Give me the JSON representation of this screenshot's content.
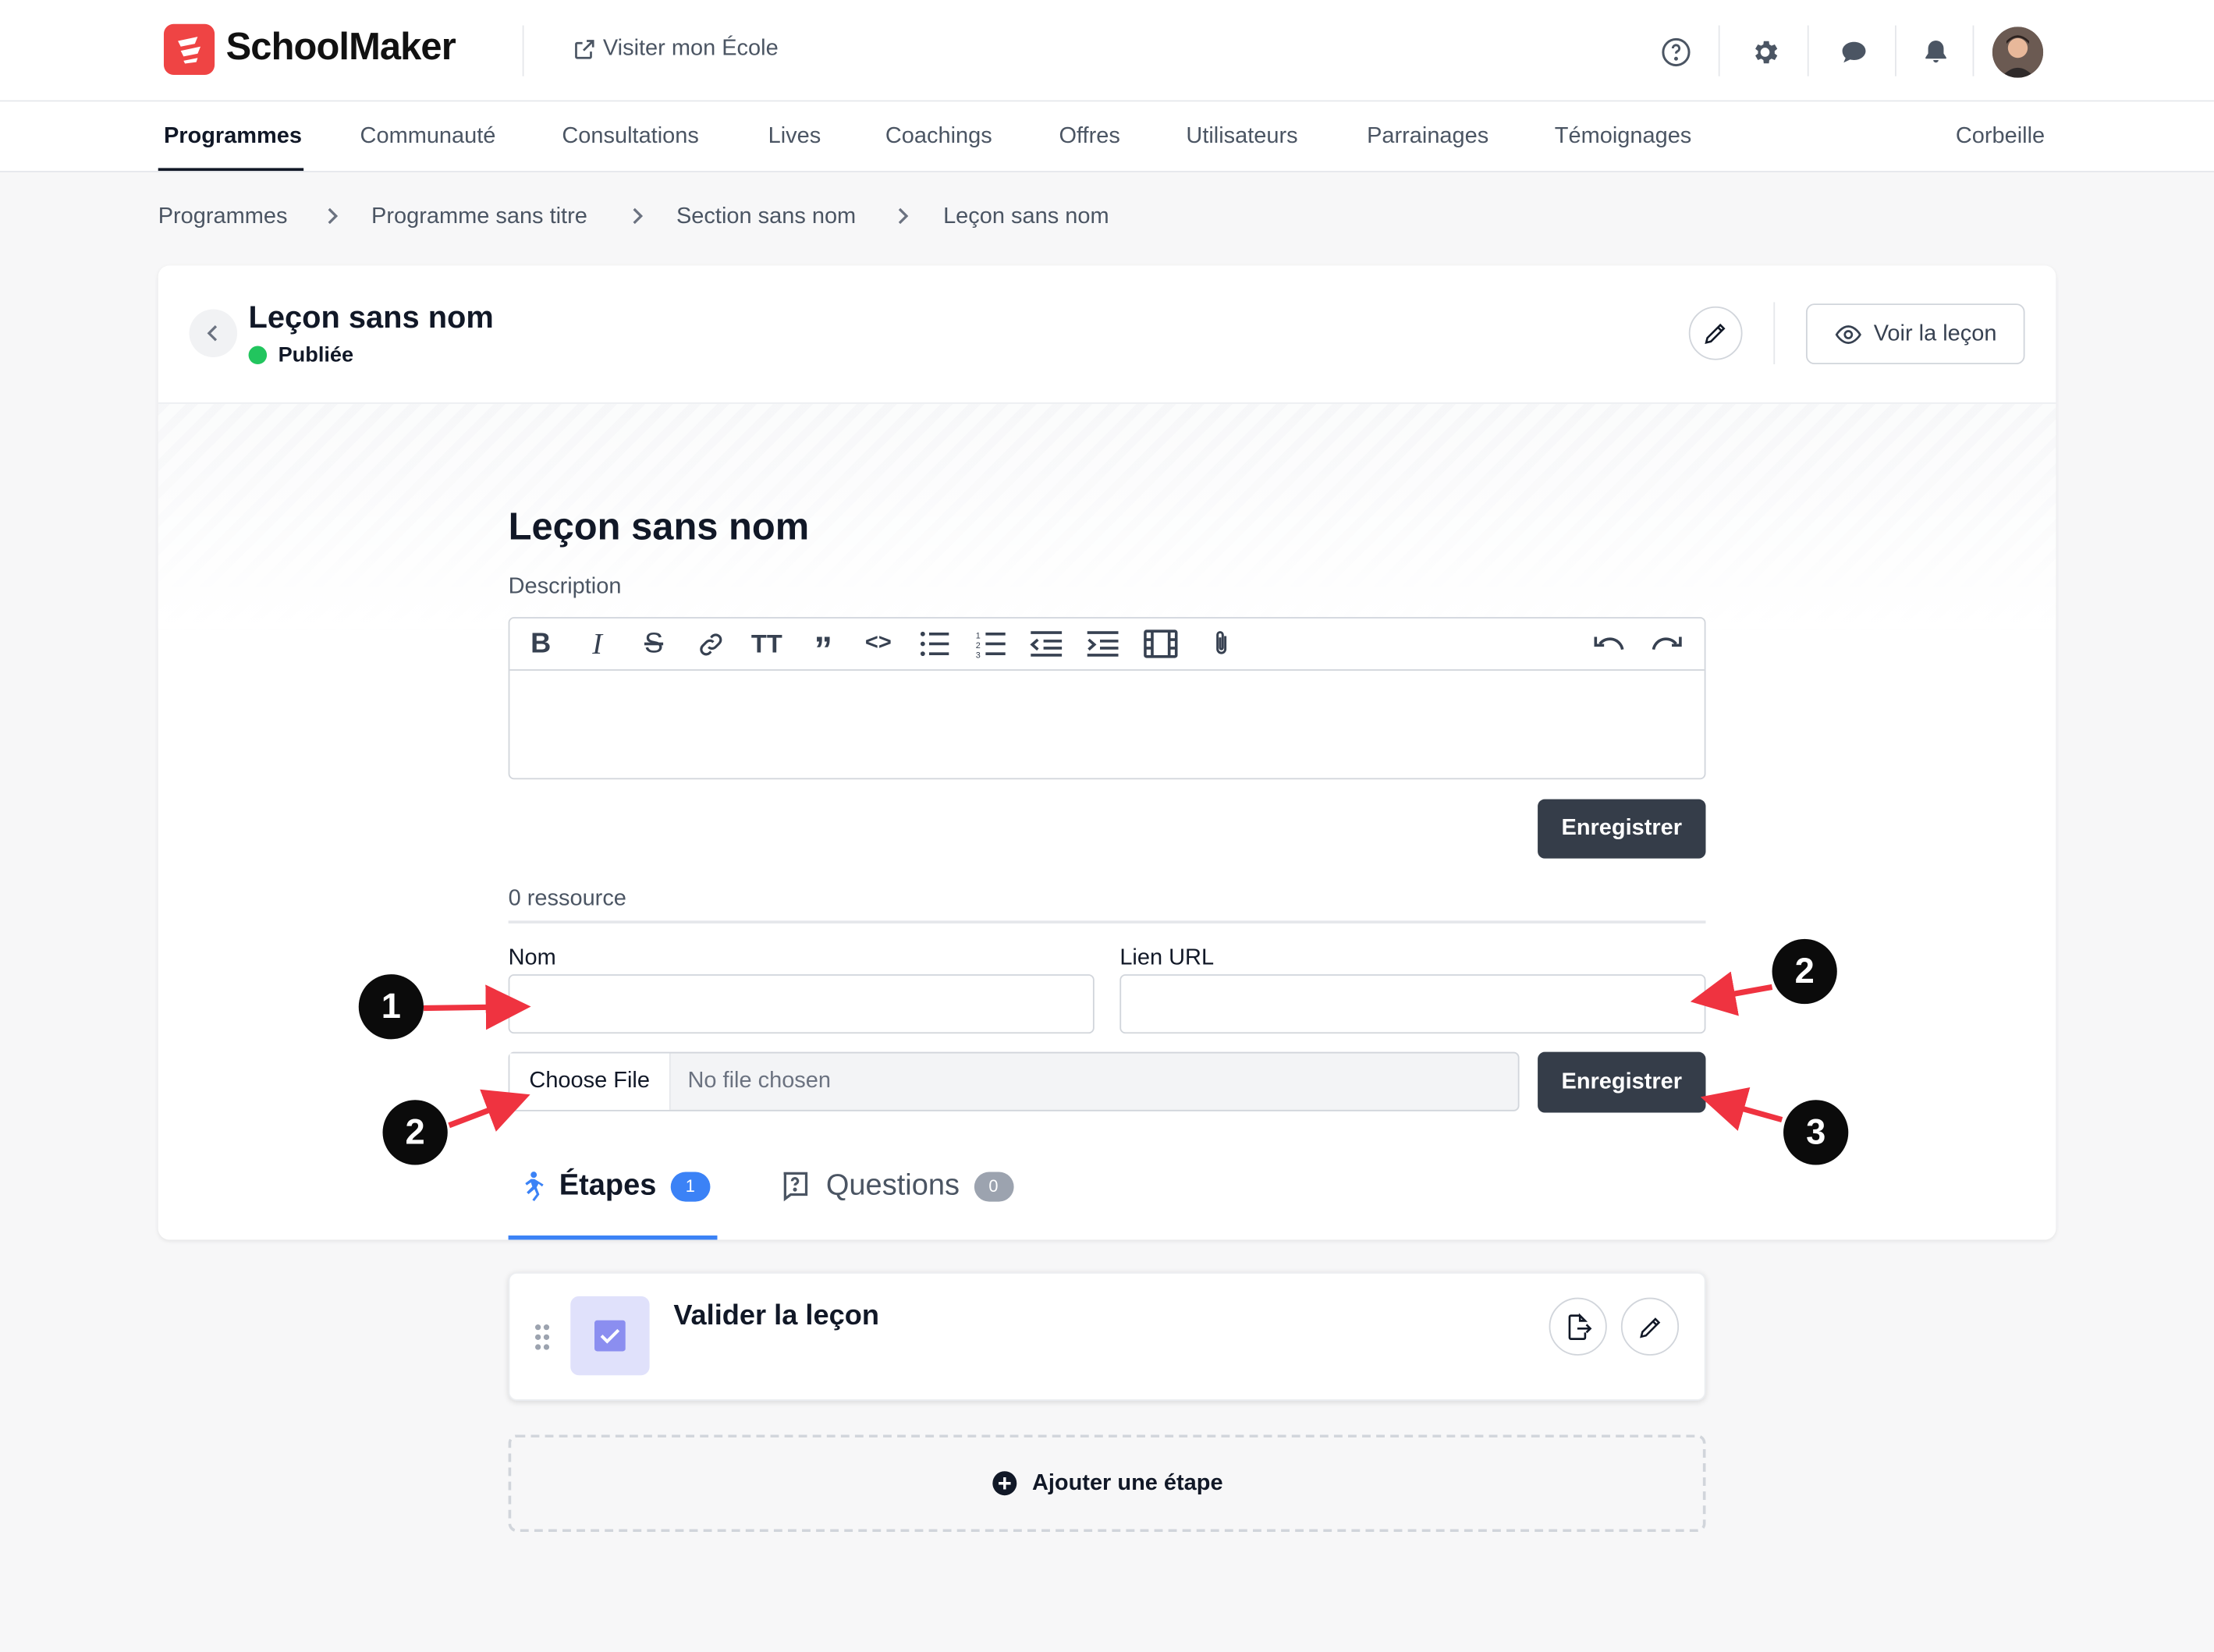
{
  "header": {
    "brand": "SchoolMaker",
    "visit_label": "Visiter mon École"
  },
  "nav": {
    "tabs": [
      "Programmes",
      "Communauté",
      "Consultations",
      "Lives",
      "Coachings",
      "Offres",
      "Utilisateurs",
      "Parrainages",
      "Témoignages"
    ],
    "trash": "Corbeille",
    "active": "Programmes"
  },
  "breadcrumb": [
    "Programmes",
    "Programme sans titre",
    "Section sans nom",
    "Leçon sans nom"
  ],
  "lesson": {
    "title": "Leçon sans nom",
    "status": "Publiée",
    "view_button": "Voir la leçon",
    "heading": "Leçon sans nom",
    "description_label": "Description",
    "save_label": "Enregistrer"
  },
  "resources": {
    "count_label": "0 ressource",
    "name_label": "Nom",
    "url_label": "Lien URL",
    "name_value": "",
    "url_value": "",
    "choose_file": "Choose File",
    "no_file": "No file chosen",
    "save_label": "Enregistrer"
  },
  "tabs": {
    "steps_label": "Étapes",
    "steps_count": "1",
    "questions_label": "Questions",
    "questions_count": "0"
  },
  "steps": [
    {
      "title": "Valider la leçon"
    }
  ],
  "add_step_label": "Ajouter une étape",
  "annotations": [
    "1",
    "2",
    "2",
    "3"
  ],
  "colors": {
    "brand": "#ef4444",
    "dark_button": "#353d49",
    "accent": "#3b82f6",
    "published": "#22c55e",
    "arrow": "#ef3340"
  }
}
